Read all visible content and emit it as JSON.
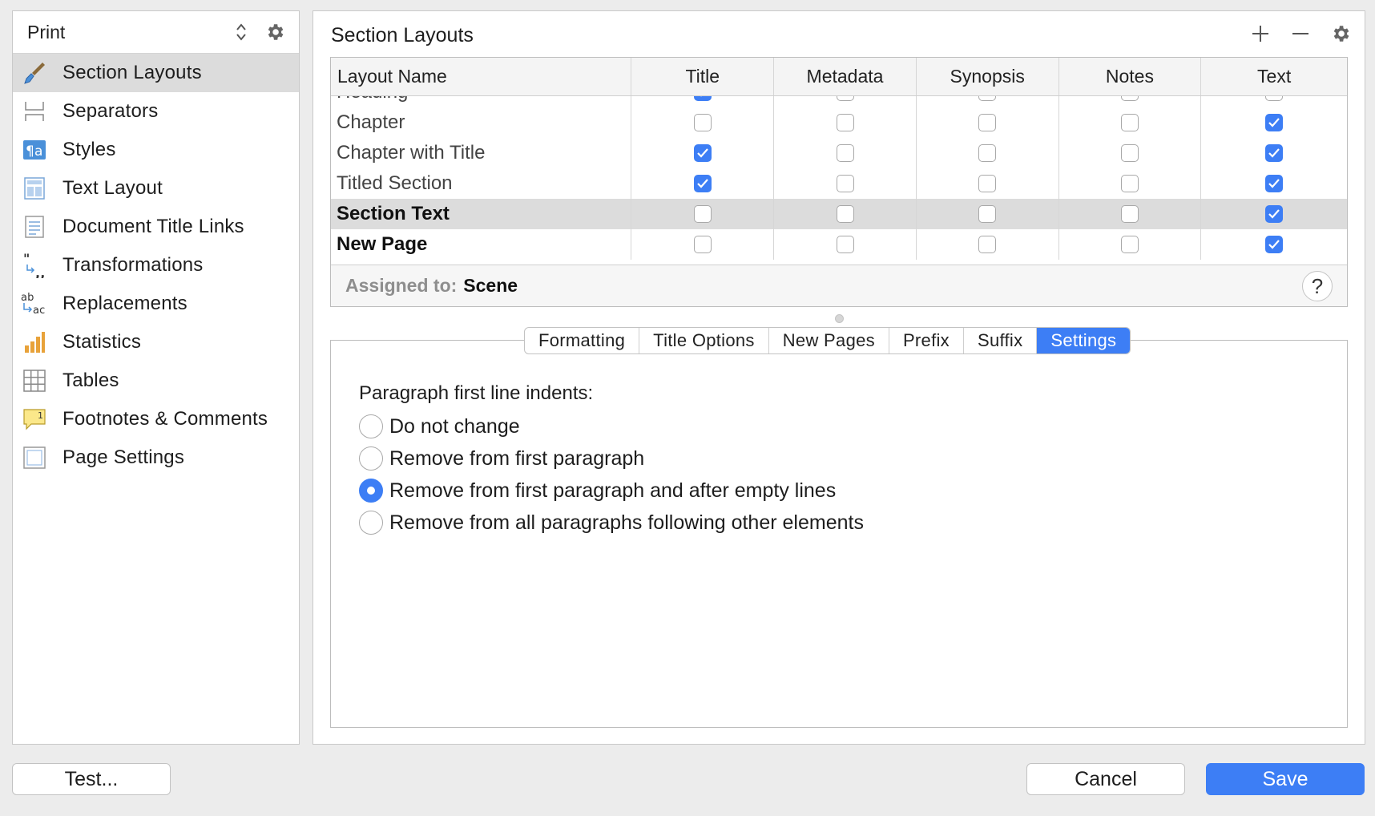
{
  "sidebar": {
    "header_title": "Print",
    "items": [
      {
        "label": "Section Layouts",
        "selected": true
      },
      {
        "label": "Separators"
      },
      {
        "label": "Styles"
      },
      {
        "label": "Text Layout"
      },
      {
        "label": "Document Title Links"
      },
      {
        "label": "Transformations"
      },
      {
        "label": "Replacements"
      },
      {
        "label": "Statistics"
      },
      {
        "label": "Tables"
      },
      {
        "label": "Footnotes & Comments"
      },
      {
        "label": "Page Settings"
      }
    ]
  },
  "main": {
    "title": "Section Layouts",
    "table": {
      "columns": [
        "Layout Name",
        "Title",
        "Metadata",
        "Synopsis",
        "Notes",
        "Text"
      ],
      "rows": [
        {
          "name": "Heading",
          "checks": [
            true,
            false,
            false,
            false,
            false
          ],
          "partial": true
        },
        {
          "name": "Chapter",
          "checks": [
            false,
            false,
            false,
            false,
            true
          ]
        },
        {
          "name": "Chapter with Title",
          "checks": [
            true,
            false,
            false,
            false,
            true
          ]
        },
        {
          "name": "Titled Section",
          "checks": [
            true,
            false,
            false,
            false,
            true
          ]
        },
        {
          "name": "Section Text",
          "checks": [
            false,
            false,
            false,
            false,
            true
          ],
          "bold": true,
          "selected": true
        },
        {
          "name": "New Page",
          "checks": [
            false,
            false,
            false,
            false,
            true
          ],
          "bold": true
        }
      ]
    },
    "assigned_label": "Assigned to:",
    "assigned_value": "Scene",
    "help_label": "?",
    "tabs": [
      {
        "label": "Formatting"
      },
      {
        "label": "Title Options"
      },
      {
        "label": "New Pages"
      },
      {
        "label": "Prefix"
      },
      {
        "label": "Suffix"
      },
      {
        "label": "Settings",
        "active": true
      }
    ],
    "settings": {
      "indent_label": "Paragraph first line indents:",
      "options": [
        {
          "label": "Do not change",
          "selected": false
        },
        {
          "label": "Remove from first paragraph",
          "selected": false
        },
        {
          "label": "Remove from first paragraph and after empty lines",
          "selected": true
        },
        {
          "label": "Remove from all paragraphs following other elements",
          "selected": false
        }
      ]
    }
  },
  "footer": {
    "test_label": "Test...",
    "cancel_label": "Cancel",
    "save_label": "Save"
  },
  "colors": {
    "accent": "#3d7ef5",
    "selected_row": "#dcdcdc"
  }
}
